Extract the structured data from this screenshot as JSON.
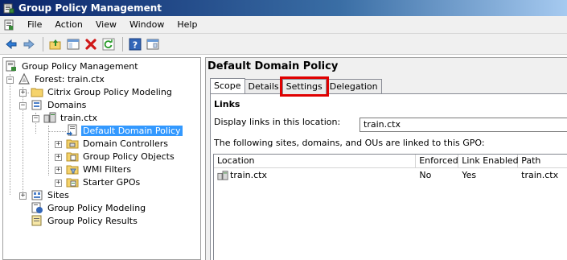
{
  "window": {
    "title": "Group Policy Management"
  },
  "menu": {
    "items": [
      "File",
      "Action",
      "View",
      "Window",
      "Help"
    ]
  },
  "toolbar": {
    "buttons": [
      "back-icon",
      "forward-icon",
      "up-folder-icon",
      "show-hide-tree-icon",
      "delete-icon",
      "refresh-icon",
      "help-icon",
      "properties-icon"
    ]
  },
  "tree": {
    "root": "Group Policy Management",
    "forest": "Forest: train.ctx",
    "citrix_modeling": "Citrix Group Policy Modeling",
    "domains": "Domains",
    "domain": "train.ctx",
    "default_policy": "Default Domain Policy",
    "domain_controllers": "Domain Controllers",
    "gpo": "Group Policy Objects",
    "wmi": "WMI Filters",
    "starter": "Starter GPOs",
    "sites": "Sites",
    "modeling": "Group Policy Modeling",
    "results": "Group Policy Results"
  },
  "detail": {
    "title": "Default Domain Policy",
    "tabs": [
      "Scope",
      "Details",
      "Settings",
      "Delegation"
    ],
    "active_tab": "Scope",
    "highlighted_tab": "Settings",
    "links_heading": "Links",
    "display_label": "Display links in this location:",
    "display_value": "train.ctx",
    "linked_text": "The following sites, domains, and OUs are linked to this GPO:",
    "columns": [
      "Location",
      "Enforced",
      "Link Enabled",
      "Path"
    ],
    "rows": [
      {
        "location": "train.ctx",
        "enforced": "No",
        "link_enabled": "Yes",
        "path": "train.ctx"
      }
    ]
  },
  "colors": {
    "selection": "#3399ff",
    "highlight_box": "#e00000",
    "titlebar": "#0a246a"
  }
}
